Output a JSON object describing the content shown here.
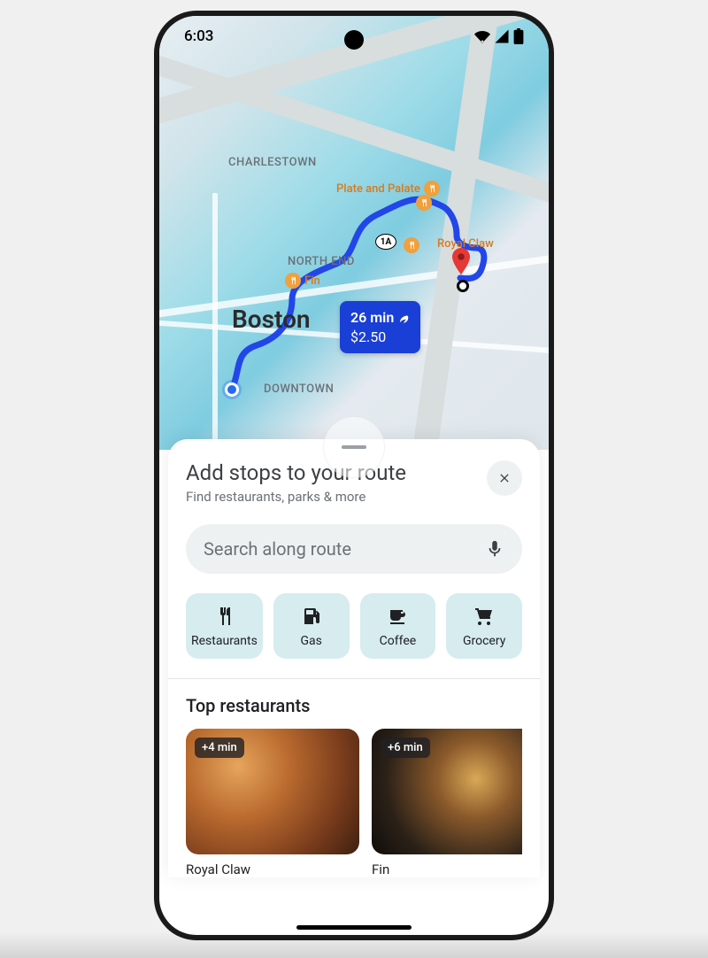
{
  "status": {
    "time": "6:03"
  },
  "map": {
    "city": "Boston",
    "labels": {
      "charlestown": "CHARLESTOWN",
      "northend": "NORTH END",
      "downtown": "DOWNTOWN"
    },
    "highway": "1A",
    "pois": {
      "plate_palate": "Plate and Palate",
      "fin": "Fin",
      "royal_claw": "Royal Claw"
    },
    "route_info": {
      "time": "26 min",
      "cost": "$2.50"
    }
  },
  "sheet": {
    "title": "Add stops to your route",
    "subtitle": "Find restaurants, parks & more",
    "search_placeholder": "Search along route",
    "categories": [
      {
        "label": "Restaurants"
      },
      {
        "label": "Gas"
      },
      {
        "label": "Coffee"
      },
      {
        "label": "Grocery"
      }
    ],
    "section_title": "Top restaurants",
    "top_restaurants": [
      {
        "name": "Royal Claw",
        "detour": "+4 min"
      },
      {
        "name": "Fin",
        "detour": "+6 min"
      }
    ]
  }
}
